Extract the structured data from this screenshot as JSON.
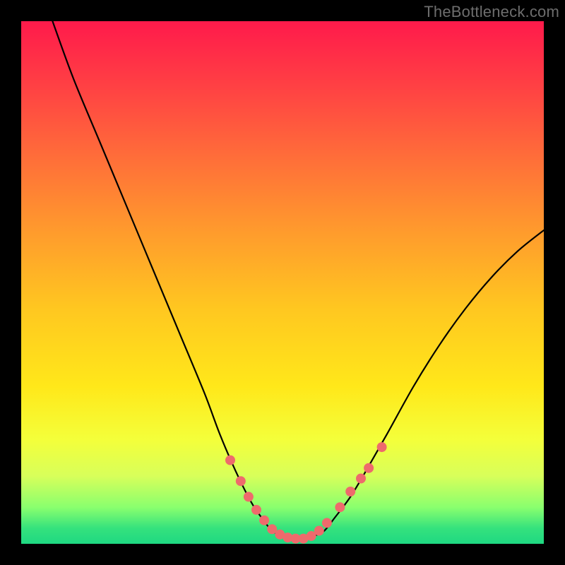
{
  "watermark": "TheBottleneck.com",
  "chart_data": {
    "type": "line",
    "title": "",
    "xlabel": "",
    "ylabel": "",
    "xlim": [
      0,
      100
    ],
    "ylim": [
      0,
      100
    ],
    "series": [
      {
        "name": "bottleneck-curve",
        "x": [
          6,
          10,
          15,
          20,
          25,
          30,
          35,
          38,
          41,
          44,
          46,
          48,
          50,
          52,
          54,
          56,
          58,
          60,
          63,
          66,
          70,
          75,
          80,
          85,
          90,
          95,
          100
        ],
        "y": [
          100,
          89,
          77,
          65,
          53,
          41,
          29,
          21,
          14,
          8,
          5,
          2.5,
          1.5,
          1,
          1,
          1.5,
          2.5,
          5,
          9,
          14,
          21,
          30,
          38,
          45,
          51,
          56,
          60
        ]
      }
    ],
    "markers": {
      "name": "highlight-dots",
      "color": "#ee6a6c",
      "points": [
        {
          "x": 40,
          "y": 16
        },
        {
          "x": 42,
          "y": 12
        },
        {
          "x": 43.5,
          "y": 9
        },
        {
          "x": 45,
          "y": 6.5
        },
        {
          "x": 46.5,
          "y": 4.5
        },
        {
          "x": 48,
          "y": 2.8
        },
        {
          "x": 49.5,
          "y": 1.8
        },
        {
          "x": 51,
          "y": 1.2
        },
        {
          "x": 52.5,
          "y": 1
        },
        {
          "x": 54,
          "y": 1
        },
        {
          "x": 55.5,
          "y": 1.5
        },
        {
          "x": 57,
          "y": 2.5
        },
        {
          "x": 58.5,
          "y": 4
        },
        {
          "x": 61,
          "y": 7
        },
        {
          "x": 63,
          "y": 10
        },
        {
          "x": 65,
          "y": 12.5
        },
        {
          "x": 66.5,
          "y": 14.5
        },
        {
          "x": 69,
          "y": 18.5
        }
      ]
    }
  }
}
